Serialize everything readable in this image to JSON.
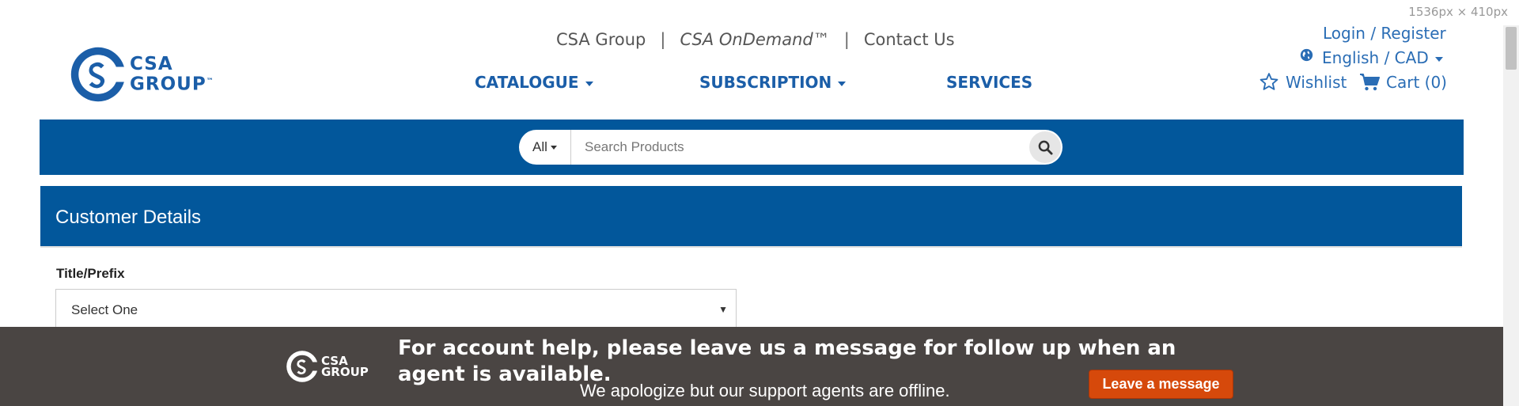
{
  "viewport_badge": "1536px × 410px",
  "brand": {
    "logo_alt": "CSA Group",
    "logo_line1": "CSA",
    "logo_line2": "GROUP",
    "trademark": "™",
    "color": "#1b5ea8"
  },
  "top_links": {
    "csa_group": "CSA Group",
    "ondemand": "CSA OnDemand™",
    "contact": "Contact Us",
    "separator": "|"
  },
  "main_nav": {
    "catalogue": "CATALOGUE",
    "subscription": "SUBSCRIPTION",
    "services": "SERVICES"
  },
  "account": {
    "login": "Login / Register",
    "language": "English / CAD",
    "wishlist": "Wishlist",
    "cart": "Cart (0)"
  },
  "search": {
    "scope": "All",
    "placeholder": "Search Products",
    "band_color": "#02579b"
  },
  "customer_details": {
    "heading": "Customer Details",
    "title_label": "Title/Prefix",
    "title_value": "Select One"
  },
  "chat": {
    "logo_line1": "CSA",
    "logo_line2": "GROUP",
    "headline": "For account help, please leave us a message for follow up when an agent is available.",
    "status": "We apologize but our support agents are offline.",
    "button": "Leave a message",
    "button_color": "#d6490b",
    "background": "#4a4543"
  },
  "icons": [
    "globe-icon",
    "star-icon",
    "cart-icon",
    "search-icon",
    "chevron-down-icon"
  ]
}
